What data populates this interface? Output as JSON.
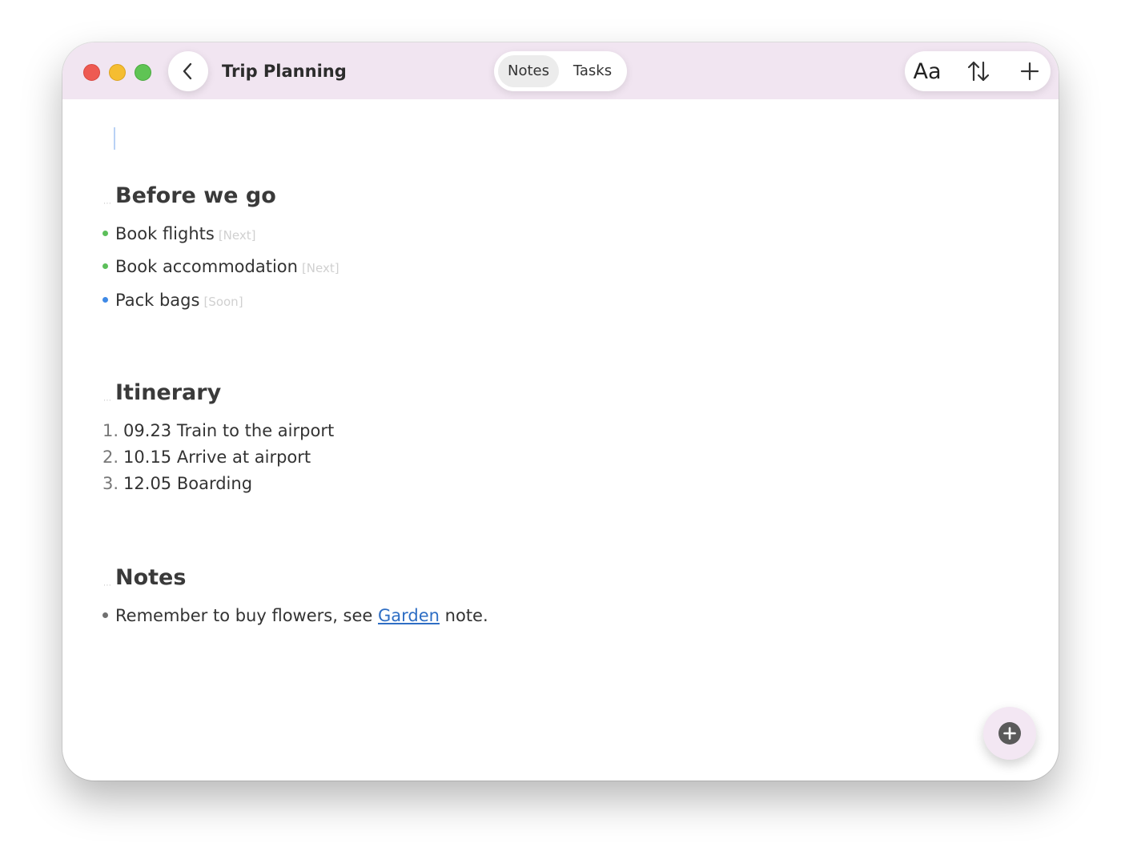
{
  "window": {
    "title": "Trip Planning",
    "tabs": [
      {
        "label": "Notes",
        "selected": true
      },
      {
        "label": "Tasks",
        "selected": false
      }
    ],
    "toolbar": {
      "font_label": "Aa",
      "sort_icon": "sort-arrows-icon",
      "add_icon": "plus-icon",
      "back_icon": "chevron-left-icon"
    }
  },
  "sections": {
    "before": {
      "heading": "Before we go",
      "items": [
        {
          "text": "Book flights",
          "tag": "[Next]",
          "dot_color": "#5cbf5a"
        },
        {
          "text": "Book accommodation",
          "tag": "[Next]",
          "dot_color": "#5cbf5a"
        },
        {
          "text": "Pack bags",
          "tag": "[Soon]",
          "dot_color": "#3f8ae6"
        }
      ]
    },
    "itinerary": {
      "heading": "Itinerary",
      "items": [
        {
          "num": "1.",
          "text": "09.23 Train to the airport"
        },
        {
          "num": "2.",
          "text": "10.15 Arrive at airport"
        },
        {
          "num": "3.",
          "text": "12.05 Boarding"
        }
      ]
    },
    "notes": {
      "heading": "Notes",
      "item": {
        "prefix": "Remember to buy flowers, see ",
        "link": "Garden",
        "suffix": " note.",
        "dot_color": "#707070"
      }
    }
  },
  "fab": {
    "icon": "plus-circle-icon"
  },
  "colors": {
    "titlebar": "#f1e5f1",
    "link": "#2e6ec4"
  }
}
